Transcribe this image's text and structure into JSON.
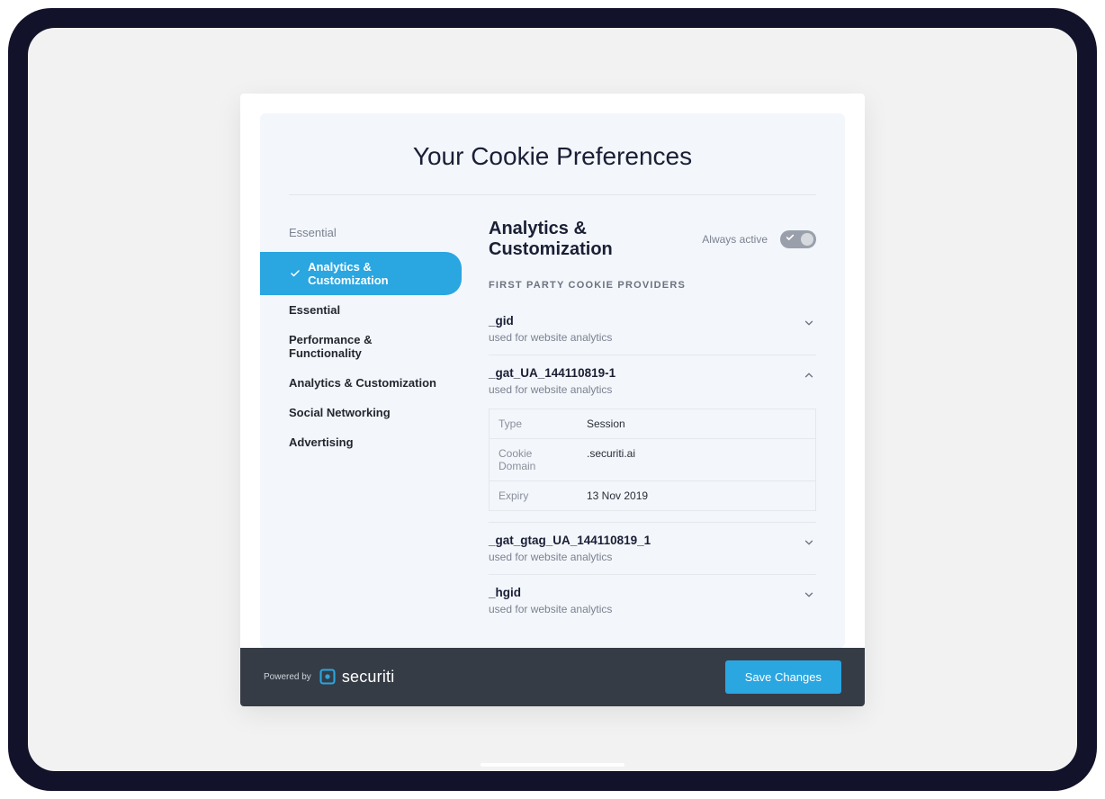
{
  "modal": {
    "title": "Your Cookie Preferences"
  },
  "sidebar": {
    "top_label": "Essential",
    "items": [
      {
        "label": "Analytics & Customization",
        "active": true
      },
      {
        "label": "Essential",
        "active": false
      },
      {
        "label": "Performance & Functionality",
        "active": false
      },
      {
        "label": "Analytics & Customization",
        "active": false
      },
      {
        "label": "Social Networking",
        "active": false
      },
      {
        "label": "Advertising",
        "active": false
      }
    ]
  },
  "content": {
    "heading": "Analytics & Customization",
    "always_active_label": "Always active",
    "section_label": "FIRST PARTY COOKIE PROVIDERS",
    "cookies": [
      {
        "name": "_gid",
        "desc": "used for website analytics",
        "expanded": false
      },
      {
        "name": "_gat_UA_144110819-1",
        "desc": "used for website analytics",
        "expanded": true,
        "details": [
          {
            "key": "Type",
            "value": "Session"
          },
          {
            "key": "Cookie Domain",
            "value": ".securiti.ai"
          },
          {
            "key": "Expiry",
            "value": "13 Nov 2019"
          }
        ]
      },
      {
        "name": "_gat_gtag_UA_144110819_1",
        "desc": "used for website analytics",
        "expanded": false
      },
      {
        "name": "_hgid",
        "desc": "used for website analytics",
        "expanded": false
      }
    ]
  },
  "footer": {
    "powered_by": "Powered by",
    "brand": "securiti",
    "save_label": "Save Changes"
  }
}
